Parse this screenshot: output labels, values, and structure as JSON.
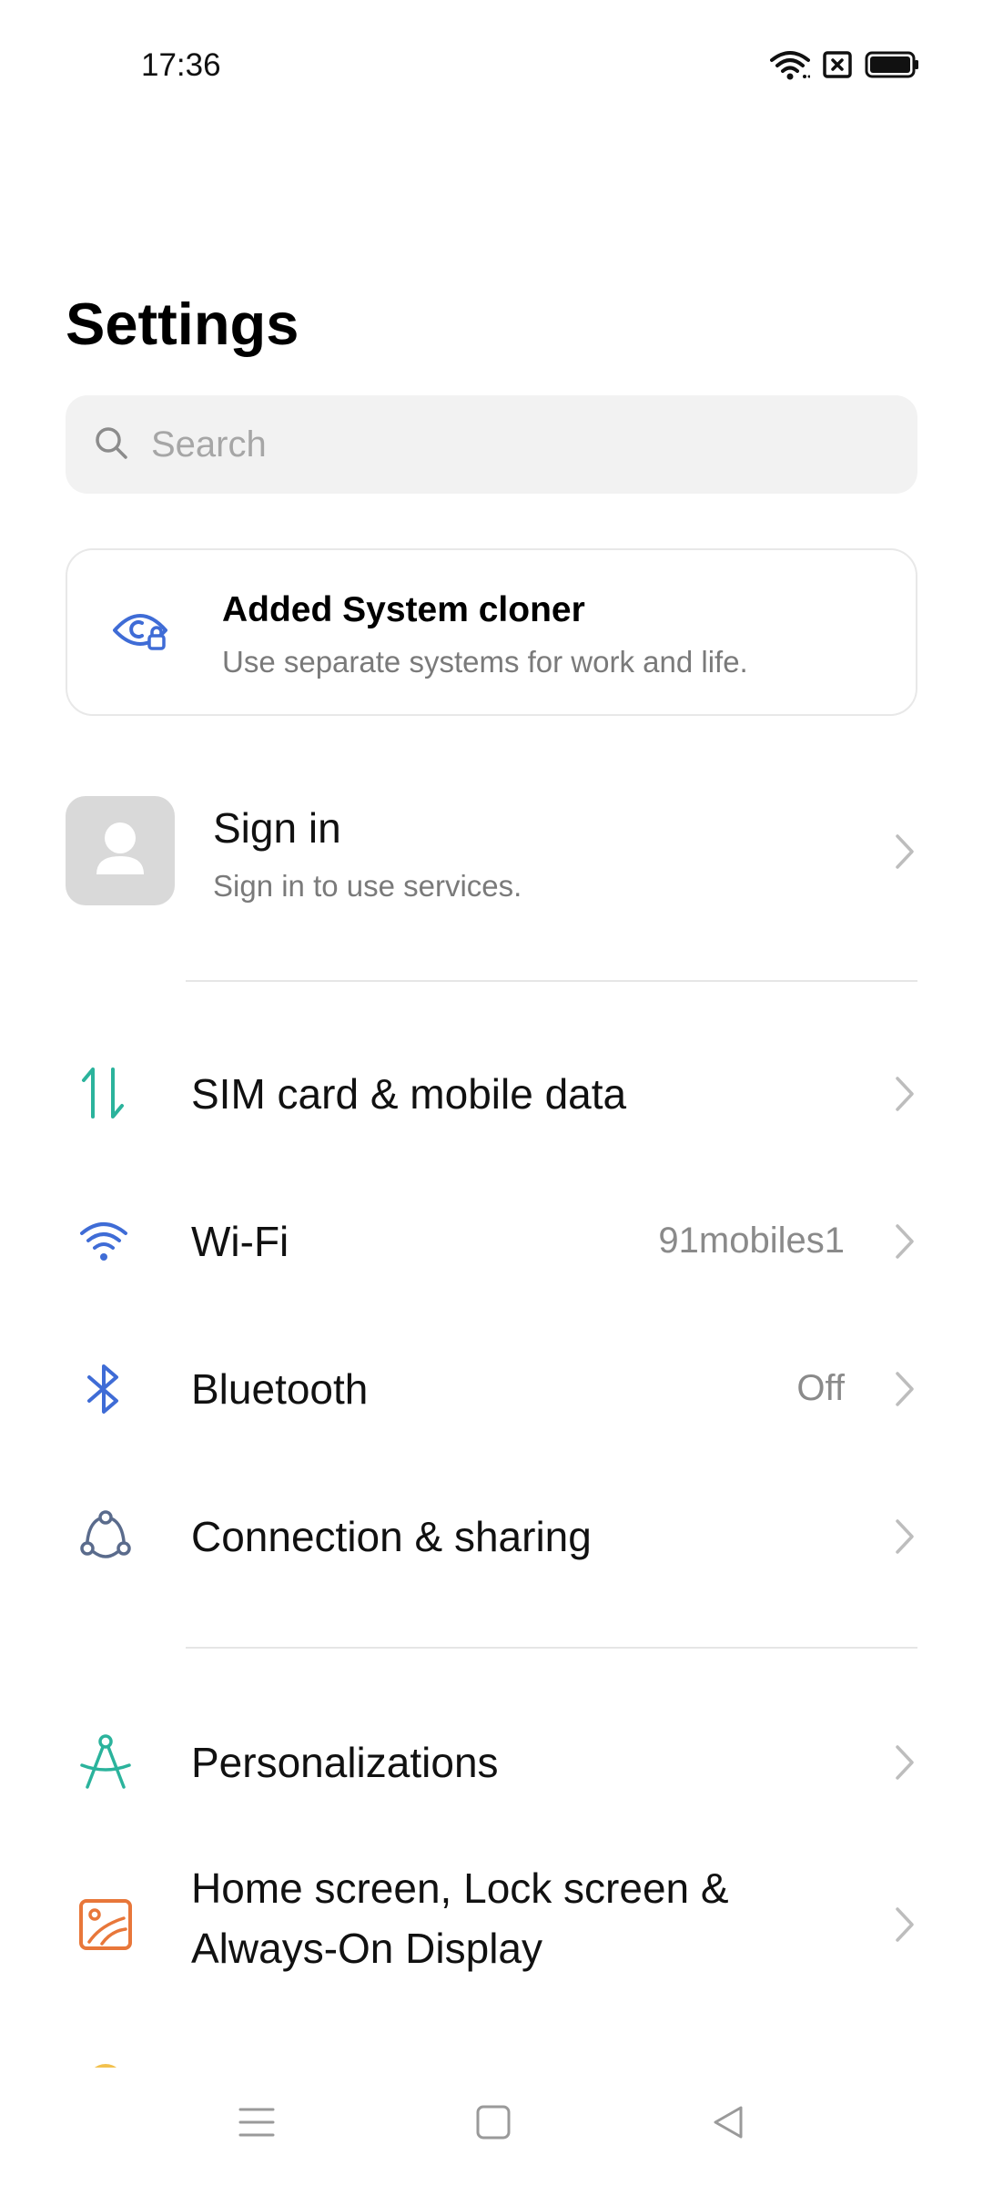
{
  "status_bar": {
    "time": "17:36",
    "icons": [
      "wifi-icon",
      "sim-error-icon",
      "battery-icon"
    ]
  },
  "title": "Settings",
  "search": {
    "placeholder": "Search",
    "value": ""
  },
  "promo": {
    "title": "Added System cloner",
    "subtitle": "Use separate systems for work and life.",
    "icon": "system-cloner-icon"
  },
  "account": {
    "title": "Sign in",
    "subtitle": "Sign in to use services.",
    "icon": "avatar-placeholder-icon"
  },
  "groups": [
    {
      "items": [
        {
          "label": "SIM card & mobile data",
          "value": "",
          "icon": "sim-data-icon"
        },
        {
          "label": "Wi-Fi",
          "value": "91mobiles1",
          "icon": "wifi-icon"
        },
        {
          "label": "Bluetooth",
          "value": "Off",
          "icon": "bluetooth-icon"
        },
        {
          "label": "Connection & sharing",
          "value": "",
          "icon": "connection-sharing-icon"
        }
      ]
    },
    {
      "items": [
        {
          "label": "Personalizations",
          "value": "",
          "icon": "personalization-icon"
        },
        {
          "label_line1": "Home screen, Lock screen &",
          "label_line2": "Always-On Display",
          "value": "",
          "icon": "home-screen-icon"
        }
      ]
    }
  ],
  "nav_bar": {
    "buttons": [
      "menu-icon",
      "home-icon",
      "back-icon"
    ]
  },
  "colors": {
    "accent_teal": "#2bb39c",
    "accent_blue": "#3f6cd6",
    "accent_orange": "#e8773a",
    "text_secondary": "#7a7a7a"
  }
}
